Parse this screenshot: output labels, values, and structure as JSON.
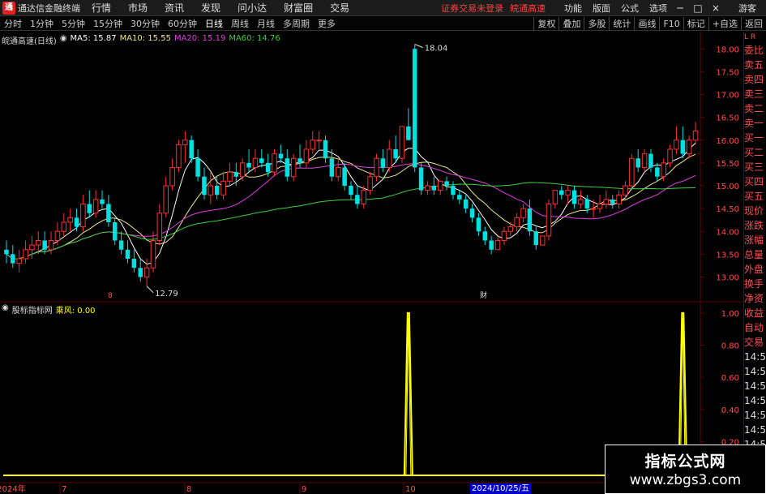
{
  "app": {
    "title": "通达信金融终端",
    "menu": [
      "行情",
      "市场",
      "资讯",
      "发现",
      "问小达",
      "财富圈",
      "交易"
    ],
    "status_message": "证券交易未登录",
    "status_stock": "皖通高速",
    "right_menu": [
      "功能",
      "版面",
      "公式",
      "选项"
    ],
    "guest": "游客",
    "window_buttons": [
      "─",
      "□",
      "×"
    ]
  },
  "toolbar": {
    "periods": [
      "分时",
      "1分钟",
      "5分钟",
      "15分钟",
      "30分钟",
      "60分钟",
      "日线",
      "周线",
      "月线",
      "多周期",
      "更多"
    ],
    "active_period": "日线",
    "right_buttons": [
      "复权",
      "叠加",
      "多股",
      "统计",
      "画线",
      "F10",
      "标记",
      "+自选",
      "返回"
    ]
  },
  "chart_header": {
    "stock": "皖通高速(日线)",
    "ma_items": [
      {
        "label": "MA5: 15.87",
        "color": "#ffffff"
      },
      {
        "label": "MA10: 15.55",
        "color": "#f0e68c"
      },
      {
        "label": "MA20: 15.19",
        "color": "#e040e0"
      },
      {
        "label": "MA60: 14.76",
        "color": "#40d040"
      }
    ]
  },
  "indicator_header": {
    "name": "股标指标网",
    "item": "乘风: 0.00"
  },
  "annotations": {
    "high_label": "18.04",
    "low_label": "12.79",
    "mark_left": "8",
    "mark_mid": "财"
  },
  "price_axis": [
    "18.00",
    "17.50",
    "17.00",
    "16.50",
    "16.00",
    "15.50",
    "15.00",
    "14.50",
    "14.00",
    "13.50",
    "13.00"
  ],
  "indicator_axis": [
    "1.00",
    "0.80",
    "0.60",
    "0.40",
    "0.20"
  ],
  "date_axis": [
    "2024年",
    "7",
    "8",
    "9",
    "10"
  ],
  "current_date": "2024/10/25/五",
  "side_panel": {
    "top": "L R",
    "items": [
      "委比",
      "卖五",
      "卖四",
      "卖三",
      "卖二",
      "卖一",
      "买一",
      "买二",
      "买三",
      "买四",
      "买五",
      "现价",
      "涨跌",
      "涨幅",
      "总量",
      "外盘",
      "换手",
      "净资",
      "收益",
      "自动",
      "交易",
      "14:5",
      "14:5",
      "14:5",
      "14:5",
      "14:5",
      "14:5",
      "14:5",
      "14:5",
      "14:5",
      "14:5"
    ]
  },
  "watermark": {
    "title": "指标公式网",
    "url": "www.zbgs3.com"
  },
  "colors": {
    "up": "#ff3030",
    "down": "#00e0e0",
    "ma5": "#ffffff",
    "ma10": "#f0e68c",
    "ma20": "#e040e0",
    "ma60": "#40d040",
    "indicator": "#ffff00",
    "grid": "#600000"
  },
  "chart_data": [
    {
      "type": "candlestick",
      "title": "皖通高速(日线)",
      "ylim": [
        12.6,
        18.2
      ],
      "x": [
        "2024-06",
        "2024-06",
        "2024-06",
        "2024-07",
        "2024-07",
        "2024-07",
        "2024-07",
        "2024-07",
        "2024-07",
        "2024-07",
        "2024-07",
        "2024-07",
        "2024-07",
        "2024-07",
        "2024-07",
        "2024-07",
        "2024-07",
        "2024-07",
        "2024-07",
        "2024-07",
        "2024-07",
        "2024-07",
        "2024-08",
        "2024-08",
        "2024-08",
        "2024-08",
        "2024-08",
        "2024-08",
        "2024-08",
        "2024-08",
        "2024-08",
        "2024-08",
        "2024-08",
        "2024-08",
        "2024-08",
        "2024-08",
        "2024-08",
        "2024-08",
        "2024-08",
        "2024-08",
        "2024-08",
        "2024-08",
        "2024-08",
        "2024-08",
        "2024-09",
        "2024-09",
        "2024-09",
        "2024-09",
        "2024-09",
        "2024-09",
        "2024-09",
        "2024-09",
        "2024-09",
        "2024-09",
        "2024-09",
        "2024-09",
        "2024-09",
        "2024-09",
        "2024-09",
        "2024-09",
        "2024-09",
        "2024-09",
        "2024-10",
        "2024-10",
        "2024-10",
        "2024-10",
        "2024-10",
        "2024-10",
        "2024-10",
        "2024-10",
        "2024-10",
        "2024-10",
        "2024-10",
        "2024-10",
        "2024-10",
        "2024-10",
        "2024-10",
        "2024-10",
        "2024-10",
        "2024-10",
        "2024-10",
        "2024-10",
        "2024-10",
        "2024-10",
        "2024-10",
        "2024-10",
        "2024-10",
        "2024-10",
        "2024-10",
        "2024-10",
        "2024-10",
        "2024-10",
        "2024-10",
        "2024-10",
        "2024-10",
        "2024-10",
        "2024-10",
        "2024-10",
        "2024-10",
        "2024-10",
        "2024-10",
        "2024-10",
        "2024-10",
        "2024-10",
        "2024-10",
        "2024-10",
        "2024-10",
        "2024-10",
        "2024-10"
      ],
      "open": [
        13.6,
        13.5,
        13.3,
        13.4,
        13.6,
        13.7,
        13.8,
        13.6,
        13.8,
        14.0,
        14.2,
        14.3,
        14.1,
        14.6,
        14.4,
        14.7,
        14.6,
        14.2,
        13.8,
        13.6,
        13.4,
        13.2,
        13.0,
        13.2,
        13.8,
        14.4,
        15.0,
        15.4,
        15.9,
        16.0,
        15.6,
        15.2,
        14.8,
        15.0,
        14.8,
        15.1,
        15.3,
        15.2,
        15.5,
        15.4,
        15.6,
        15.5,
        15.3,
        15.7,
        15.6,
        15.2,
        15.6,
        15.5,
        15.8,
        16.0,
        16.0,
        15.6,
        15.2,
        15.4,
        15.0,
        14.8,
        14.6,
        14.9,
        15.2,
        15.6,
        15.4,
        15.8,
        15.6,
        16.3,
        18.0,
        15.4,
        14.9,
        15.0,
        14.9,
        15.1,
        15.0,
        14.8,
        14.7,
        14.5,
        14.3,
        14.0,
        13.8,
        13.6,
        13.8,
        14.0,
        14.1,
        14.3,
        14.5,
        14.0,
        13.7,
        13.9,
        14.6,
        14.9,
        14.8,
        14.9,
        14.6,
        14.7,
        14.5,
        14.5,
        14.6,
        14.7,
        14.6,
        14.8,
        15.0,
        15.6,
        15.4,
        15.7,
        15.4,
        15.2,
        15.5,
        15.8,
        16.0,
        15.7,
        16.0
      ],
      "high": [
        13.8,
        13.7,
        13.6,
        13.8,
        13.9,
        14.0,
        14.0,
        14.0,
        14.2,
        14.4,
        14.5,
        14.5,
        14.8,
        14.9,
        14.9,
        14.9,
        14.8,
        14.3,
        14.0,
        13.8,
        13.6,
        13.4,
        13.4,
        14.0,
        14.6,
        15.2,
        15.6,
        16.0,
        16.2,
        16.1,
        15.8,
        15.4,
        15.3,
        15.2,
        15.3,
        15.5,
        15.5,
        15.6,
        15.8,
        15.8,
        15.8,
        15.7,
        15.8,
        15.9,
        15.8,
        15.7,
        15.9,
        16.0,
        16.2,
        16.2,
        16.1,
        15.8,
        15.6,
        15.5,
        15.1,
        15.0,
        15.0,
        15.3,
        15.7,
        15.8,
        16.0,
        16.1,
        16.3,
        16.7,
        18.1,
        15.5,
        15.1,
        15.2,
        15.1,
        15.2,
        15.1,
        14.9,
        14.8,
        14.6,
        14.4,
        14.1,
        13.9,
        13.9,
        14.1,
        14.2,
        14.4,
        14.6,
        14.7,
        14.1,
        13.9,
        14.7,
        14.9,
        15.0,
        15.0,
        15.0,
        14.9,
        14.8,
        14.7,
        14.8,
        14.9,
        14.8,
        14.9,
        15.1,
        15.7,
        15.8,
        15.8,
        15.8,
        15.5,
        15.6,
        15.9,
        16.3,
        16.3,
        16.1,
        16.4
      ],
      "low": [
        13.3,
        13.2,
        13.1,
        13.3,
        13.4,
        13.5,
        13.5,
        13.5,
        13.7,
        13.9,
        14.0,
        14.0,
        14.0,
        14.3,
        14.3,
        14.5,
        14.1,
        13.7,
        13.5,
        13.3,
        13.1,
        12.9,
        12.8,
        13.1,
        13.7,
        14.3,
        14.9,
        15.3,
        15.5,
        15.5,
        15.1,
        14.7,
        14.6,
        14.7,
        14.7,
        15.0,
        15.0,
        15.1,
        15.3,
        15.3,
        15.4,
        15.2,
        15.2,
        15.5,
        15.1,
        15.1,
        15.4,
        15.4,
        15.7,
        15.8,
        15.5,
        15.1,
        15.1,
        14.9,
        14.7,
        14.5,
        14.5,
        14.8,
        15.1,
        15.3,
        15.3,
        15.5,
        15.5,
        16.2,
        15.3,
        14.8,
        14.8,
        14.8,
        14.8,
        14.9,
        14.7,
        14.6,
        14.4,
        14.2,
        13.9,
        13.7,
        13.5,
        13.6,
        13.7,
        13.9,
        14.0,
        14.2,
        13.9,
        13.6,
        13.7,
        13.8,
        14.5,
        14.7,
        14.6,
        14.5,
        14.5,
        14.4,
        14.3,
        14.4,
        14.5,
        14.5,
        14.5,
        14.7,
        14.9,
        15.3,
        15.3,
        15.3,
        15.1,
        15.1,
        15.4,
        15.7,
        15.6,
        15.6,
        15.9
      ],
      "close": [
        13.5,
        13.3,
        13.4,
        13.6,
        13.7,
        13.8,
        13.6,
        13.8,
        14.0,
        14.2,
        14.3,
        14.1,
        14.6,
        14.4,
        14.7,
        14.6,
        14.2,
        13.8,
        13.6,
        13.4,
        13.2,
        13.0,
        13.2,
        13.8,
        14.4,
        15.0,
        15.4,
        15.9,
        16.0,
        15.6,
        15.2,
        14.8,
        15.0,
        14.8,
        15.1,
        15.3,
        15.2,
        15.5,
        15.4,
        15.6,
        15.5,
        15.3,
        15.7,
        15.6,
        15.2,
        15.6,
        15.5,
        15.8,
        16.0,
        16.0,
        15.6,
        15.2,
        15.4,
        15.0,
        14.8,
        14.6,
        14.9,
        15.2,
        15.6,
        15.4,
        15.8,
        15.6,
        16.3,
        16.0,
        15.4,
        14.9,
        15.0,
        14.9,
        15.1,
        15.0,
        14.8,
        14.7,
        14.5,
        14.3,
        14.0,
        13.8,
        13.6,
        13.8,
        14.0,
        14.1,
        14.3,
        14.5,
        14.0,
        13.7,
        13.9,
        14.6,
        14.9,
        14.8,
        14.9,
        14.6,
        14.7,
        14.5,
        14.5,
        14.6,
        14.7,
        14.6,
        14.8,
        15.0,
        15.6,
        15.4,
        15.7,
        15.4,
        15.2,
        15.5,
        15.8,
        16.0,
        15.7,
        16.0,
        16.2
      ]
    },
    {
      "type": "line",
      "title": "乘风",
      "ylim": [
        0,
        1.05
      ],
      "series": [
        {
          "name": "乘风",
          "spikes_at_index": [
            63,
            106
          ],
          "peak": 1.0
        }
      ]
    }
  ]
}
